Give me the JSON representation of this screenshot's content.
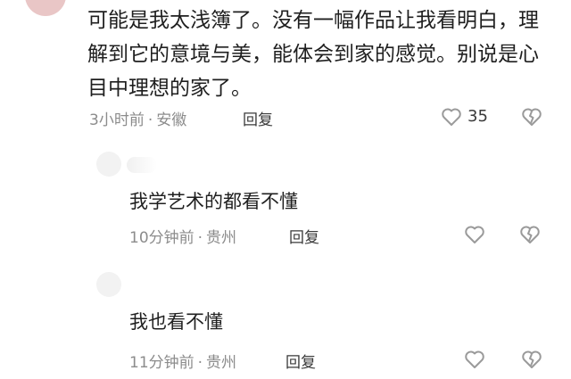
{
  "comments": [
    {
      "text": "可能是我太浅簿了。没有一幅作品让我看明白，理解到它的意境与美，能体会到家的感觉。别说是心目中理想的家了。",
      "time": "3小时前",
      "location": "安徽",
      "reply_label": "回复",
      "likes": "35"
    }
  ],
  "replies": [
    {
      "text": "我学艺术的都看不懂",
      "time": "10分钟前",
      "location": "贵州",
      "reply_label": "回复"
    },
    {
      "text": "我也看不懂",
      "time": "11分钟前",
      "location": "贵州",
      "reply_label": "回复"
    }
  ],
  "meta": {
    "separator": "·"
  },
  "icons": {
    "like": "heart-outline-icon",
    "dislike": "broken-heart-icon"
  },
  "colors": {
    "text": "#1f1f1f",
    "meta": "#8c8c8c",
    "icon": "#9a9a9a"
  }
}
